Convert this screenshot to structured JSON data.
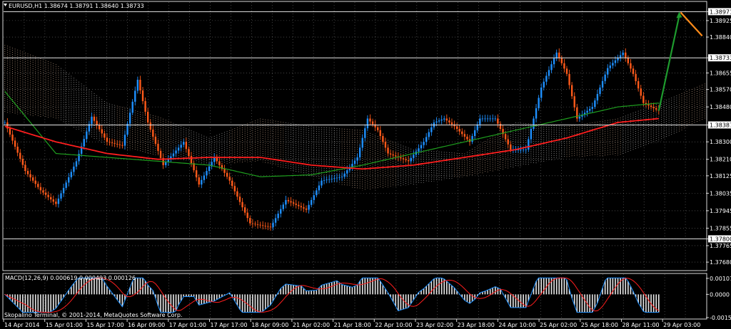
{
  "main_panel": {
    "symbol_info": "EURUSD,H1  1.38674 1.38791 1.38640 1.38733"
  },
  "macd_panel": {
    "info": "MACD(12,26,9) 0.000619 0.000493 0.000126"
  },
  "copyright": "Skopalino Terminal, © 2001-2014, MetaQuotes Software Corp.",
  "colors": {
    "background": "#000000",
    "bull_candle": "#1e90ff",
    "bear_candle": "#ff5a1a",
    "sma_red": "#ff1e1e",
    "sma_green": "#1fa01f",
    "cloud_bull": "#e8c0a0",
    "cloud_bear": "#d0d0d0",
    "arrow_up": "#1e9b2e",
    "arrow_down": "#ff8c1a",
    "grid": "#c8c8c8"
  },
  "chart_data": [
    {
      "type": "candlestick",
      "symbol": "EURUSD",
      "timeframe": "H1",
      "ohlc_current": {
        "open": 1.38674,
        "high": 1.38791,
        "low": 1.3864,
        "close": 1.38733
      },
      "ylim": [
        1.3764,
        1.3902
      ],
      "y_ticks": [
        "1.38971",
        "1.38925",
        "1.38840",
        "1.38733",
        "1.38655",
        "1.38570",
        "1.38480",
        "1.38387",
        "1.38300",
        "1.38210",
        "1.38125",
        "1.38035",
        "1.37945",
        "1.37855",
        "1.37800",
        "1.37765",
        "1.37680"
      ],
      "x_ticks": [
        "14 Apr 2014",
        "15 Apr 01:00",
        "15 Apr 17:00",
        "16 Apr 09:00",
        "17 Apr 01:00",
        "17 Apr 17:00",
        "18 Apr 09:00",
        "21 Apr 02:00",
        "21 Apr 18:00",
        "22 Apr 10:00",
        "23 Apr 02:00",
        "23 Apr 18:00",
        "24 Apr 10:00",
        "25 Apr 02:00",
        "25 Apr 18:00",
        "28 Apr 11:00",
        "29 Apr 03:00"
      ],
      "highlighted_levels": [
        1.38971,
        1.38733,
        1.38387,
        1.378
      ],
      "price_path": [
        [
          0,
          1.384
        ],
        [
          8,
          1.3815
        ],
        [
          14,
          1.3805
        ],
        [
          20,
          1.3798
        ],
        [
          28,
          1.382
        ],
        [
          34,
          1.3843
        ],
        [
          40,
          1.383
        ],
        [
          46,
          1.3828
        ],
        [
          52,
          1.3862
        ],
        [
          56,
          1.384
        ],
        [
          62,
          1.3818
        ],
        [
          70,
          1.383
        ],
        [
          76,
          1.3808
        ],
        [
          82,
          1.3822
        ],
        [
          88,
          1.381
        ],
        [
          96,
          1.3788
        ],
        [
          104,
          1.3786
        ],
        [
          110,
          1.38
        ],
        [
          118,
          1.3795
        ],
        [
          124,
          1.381
        ],
        [
          132,
          1.3812
        ],
        [
          138,
          1.3822
        ],
        [
          142,
          1.3842
        ],
        [
          146,
          1.3836
        ],
        [
          150,
          1.3824
        ],
        [
          158,
          1.382
        ],
        [
          164,
          1.383
        ],
        [
          168,
          1.384
        ],
        [
          172,
          1.3842
        ],
        [
          176,
          1.3838
        ],
        [
          182,
          1.383
        ],
        [
          186,
          1.3842
        ],
        [
          192,
          1.3842
        ],
        [
          198,
          1.3826
        ],
        [
          204,
          1.3826
        ],
        [
          210,
          1.3858
        ],
        [
          216,
          1.3876
        ],
        [
          220,
          1.3865
        ],
        [
          224,
          1.3842
        ],
        [
          230,
          1.3848
        ],
        [
          236,
          1.3868
        ],
        [
          242,
          1.3876
        ],
        [
          246,
          1.3865
        ],
        [
          250,
          1.385
        ],
        [
          256,
          1.3846
        ]
      ],
      "sma_red": [
        [
          0,
          1.3838
        ],
        [
          20,
          1.383
        ],
        [
          40,
          1.3824
        ],
        [
          60,
          1.3821
        ],
        [
          80,
          1.3822
        ],
        [
          100,
          1.3822
        ],
        [
          120,
          1.3818
        ],
        [
          140,
          1.3816
        ],
        [
          160,
          1.3818
        ],
        [
          180,
          1.3822
        ],
        [
          200,
          1.3826
        ],
        [
          220,
          1.3832
        ],
        [
          240,
          1.384
        ],
        [
          256,
          1.3842
        ]
      ],
      "sma_green": [
        [
          0,
          1.3856
        ],
        [
          20,
          1.3824
        ],
        [
          40,
          1.3822
        ],
        [
          60,
          1.382
        ],
        [
          80,
          1.3818
        ],
        [
          100,
          1.3812
        ],
        [
          120,
          1.3813
        ],
        [
          140,
          1.3818
        ],
        [
          160,
          1.3824
        ],
        [
          180,
          1.383
        ],
        [
          200,
          1.3836
        ],
        [
          220,
          1.3842
        ],
        [
          240,
          1.3848
        ],
        [
          256,
          1.385
        ]
      ],
      "cloud": [
        [
          0,
          1.388,
          1.3845
        ],
        [
          20,
          1.387,
          1.3842
        ],
        [
          40,
          1.385,
          1.3828
        ],
        [
          60,
          1.3843,
          1.3823
        ],
        [
          80,
          1.3832,
          1.3818
        ],
        [
          100,
          1.3842,
          1.382
        ],
        [
          120,
          1.3838,
          1.3812
        ],
        [
          140,
          1.3836,
          1.3805
        ],
        [
          160,
          1.3826,
          1.3808
        ],
        [
          180,
          1.3824,
          1.3812
        ],
        [
          200,
          1.384,
          1.3817
        ],
        [
          220,
          1.3838,
          1.3822
        ],
        [
          240,
          1.3842,
          1.3823
        ],
        [
          256,
          1.385,
          1.383
        ],
        [
          274,
          1.386,
          1.3842
        ]
      ]
    },
    {
      "type": "histogram",
      "indicator": "MACD(12,26,9)",
      "values_current": {
        "main": 0.000619,
        "signal": 0.000493,
        "histogram": 0.000126
      },
      "ylim": [
        -0.0016,
        0.00135
      ],
      "y_ticks": [
        "0.00107",
        "0.0000",
        "-0.00155"
      ]
    }
  ]
}
